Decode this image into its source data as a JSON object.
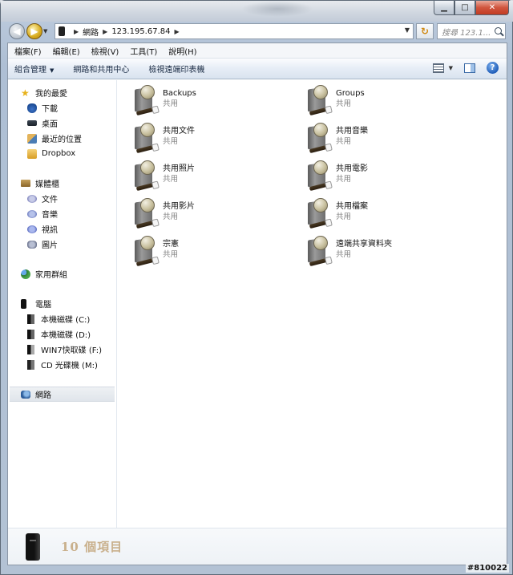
{
  "address": {
    "parts": [
      "網路",
      "123.195.67.84"
    ],
    "search_placeholder": "搜尋 123.1..."
  },
  "menu": [
    "檔案(F)",
    "編輯(E)",
    "檢視(V)",
    "工具(T)",
    "說明(H)"
  ],
  "commands": {
    "organize": "組合管理",
    "network_center": "網路和共用中心",
    "printers": "檢視遠端印表機"
  },
  "navpane": {
    "favorites": {
      "label": "我的最愛",
      "items": [
        "下載",
        "桌面",
        "最近的位置",
        "Dropbox"
      ]
    },
    "libraries": {
      "label": "媒體櫃",
      "items": [
        "文件",
        "音樂",
        "視訊",
        "圖片"
      ]
    },
    "homegroup": "家用群組",
    "computer": {
      "label": "電腦",
      "items": [
        "本機磁碟 (C:)",
        "本機磁碟 (D:)",
        "WIN7快取碟 (F:)",
        "CD 光碟機 (M:)"
      ]
    },
    "network": "網路"
  },
  "shares": [
    {
      "name": "Backups",
      "type": "共用"
    },
    {
      "name": "Groups",
      "type": "共用"
    },
    {
      "name": "共用文件",
      "type": "共用"
    },
    {
      "name": "共用音樂",
      "type": "共用"
    },
    {
      "name": "共用照片",
      "type": "共用"
    },
    {
      "name": "共用電影",
      "type": "共用"
    },
    {
      "name": "共用影片",
      "type": "共用"
    },
    {
      "name": "共用檔案",
      "type": "共用"
    },
    {
      "name": "宗憲",
      "type": "共用"
    },
    {
      "name": "遠端共享資料夾",
      "type": "共用"
    }
  ],
  "details": {
    "count_text": "10 個項目"
  },
  "watermark": "#810022"
}
